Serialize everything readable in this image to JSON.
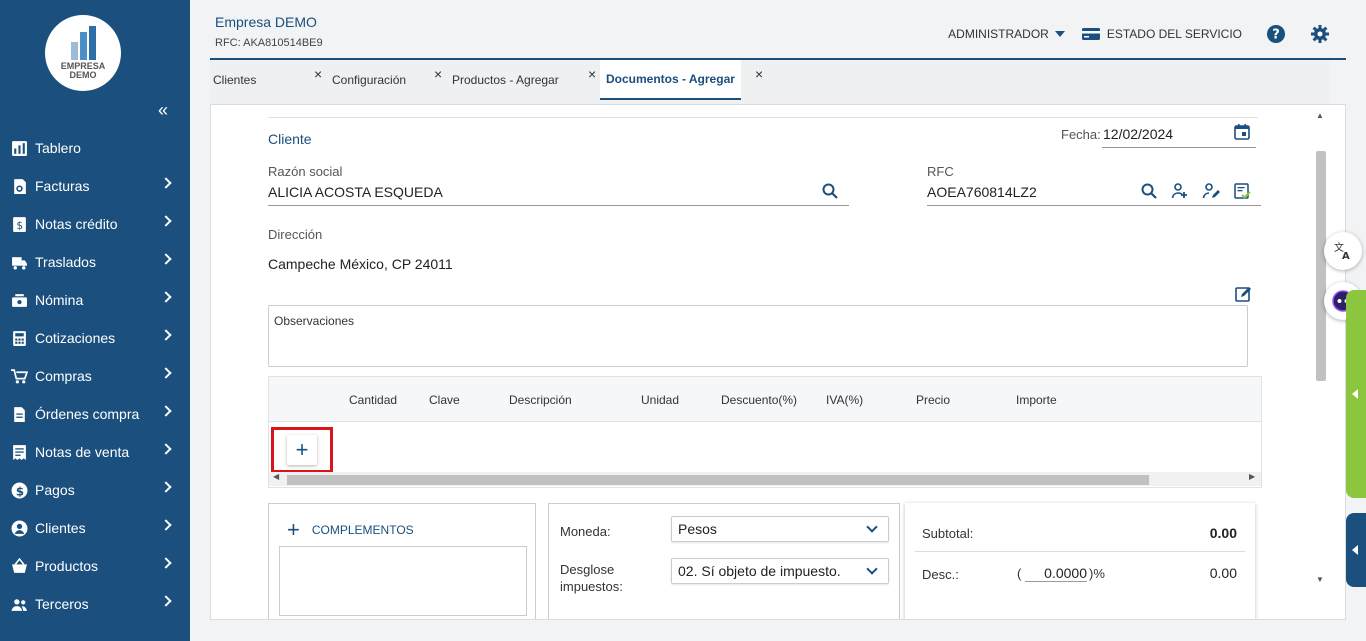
{
  "sidebar": {
    "logo_line1": "EMPRESA",
    "logo_line2": "DEMO",
    "collapse_label": "«",
    "items": [
      {
        "label": "Tablero",
        "icon": "dashboard-icon"
      },
      {
        "label": "Facturas",
        "icon": "invoice-icon"
      },
      {
        "label": "Notas crédito",
        "icon": "credit-note-icon"
      },
      {
        "label": "Traslados",
        "icon": "truck-icon"
      },
      {
        "label": "Nómina",
        "icon": "payroll-icon"
      },
      {
        "label": "Cotizaciones",
        "icon": "calculator-icon"
      },
      {
        "label": "Compras",
        "icon": "cart-icon"
      },
      {
        "label": "Órdenes compra",
        "icon": "document-icon"
      },
      {
        "label": "Notas de venta",
        "icon": "receipt-icon"
      },
      {
        "label": "Pagos",
        "icon": "dollar-icon"
      },
      {
        "label": "Clientes",
        "icon": "user-icon"
      },
      {
        "label": "Productos",
        "icon": "basket-icon"
      },
      {
        "label": "Terceros",
        "icon": "users-icon"
      }
    ]
  },
  "header": {
    "company": "Empresa DEMO",
    "rfc": "RFC: AKA810514BE9",
    "user": "ADMINISTRADOR",
    "service_status": "ESTADO DEL SERVICIO"
  },
  "tabs": [
    {
      "label": "Clientes"
    },
    {
      "label": "Configuración"
    },
    {
      "label": "Productos - Agregar"
    },
    {
      "label": "Documentos - Agregar",
      "active": true
    }
  ],
  "tab_close": "×",
  "form": {
    "section_title": "Cliente",
    "fecha_label": "Fecha:",
    "fecha_value": "12/02/2024",
    "razon_label": "Razón social",
    "razon_value": "ALICIA ACOSTA ESQUEDA",
    "rfc_label": "RFC",
    "rfc_value": "AOEA760814LZ2",
    "direccion_label": "Dirección",
    "direccion_value": "Campeche México, CP 24011",
    "observaciones_placeholder": "Observaciones"
  },
  "grid": {
    "columns": [
      "Cantidad",
      "Clave",
      "Descripción",
      "Unidad",
      "Descuento(%)",
      "IVA(%)",
      "Precio",
      "Importe"
    ],
    "add_label": "+"
  },
  "complementos": {
    "label": "COMPLEMENTOS",
    "plus": "+"
  },
  "moneda": {
    "label": "Moneda:",
    "value": "Pesos",
    "desglose_label_1": "Desglose",
    "desglose_label_2": "impuestos:",
    "desglose_value": "02. Sí objeto de impuesto."
  },
  "totales": {
    "subtotal_label": "Subtotal:",
    "subtotal_value": "0.00",
    "desc_label": "Desc.:",
    "desc_open": "(",
    "desc_percent": "0.0000",
    "desc_close": ")%",
    "desc_value": "0.00"
  },
  "colors": {
    "primary": "#1a4f7e",
    "accent_green": "#8cc63f",
    "highlight_red": "#d9141b"
  }
}
